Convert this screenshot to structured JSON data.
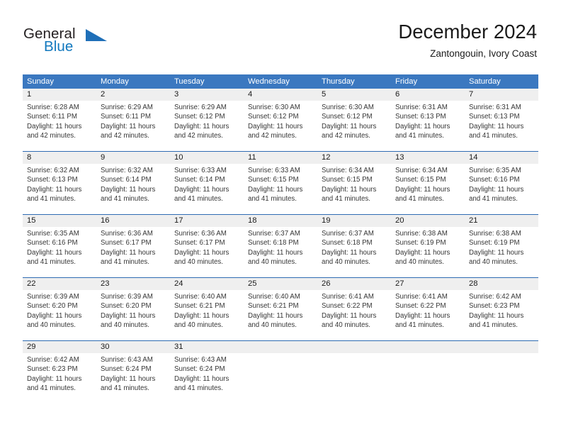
{
  "brand": {
    "name_part1": "General",
    "name_part2": "Blue",
    "triangle_icon": "triangle-icon",
    "colors": {
      "general": "#231f20",
      "blue": "#1278be",
      "triangle": "#1f6fb8"
    }
  },
  "header": {
    "title": "December 2024",
    "subtitle": "Zantongouin, Ivory Coast"
  },
  "theme": {
    "header_bar": "#3b78c0",
    "header_text": "#ffffff",
    "day_number_band": "#efefef",
    "separator": "#2f6cb3",
    "body_text": "#363636"
  },
  "weekdays": [
    "Sunday",
    "Monday",
    "Tuesday",
    "Wednesday",
    "Thursday",
    "Friday",
    "Saturday"
  ],
  "weeks": [
    {
      "days": [
        {
          "num": "1",
          "sunrise": "Sunrise: 6:28 AM",
          "sunset": "Sunset: 6:11 PM",
          "daylight1": "Daylight: 11 hours",
          "daylight2": "and 42 minutes."
        },
        {
          "num": "2",
          "sunrise": "Sunrise: 6:29 AM",
          "sunset": "Sunset: 6:11 PM",
          "daylight1": "Daylight: 11 hours",
          "daylight2": "and 42 minutes."
        },
        {
          "num": "3",
          "sunrise": "Sunrise: 6:29 AM",
          "sunset": "Sunset: 6:12 PM",
          "daylight1": "Daylight: 11 hours",
          "daylight2": "and 42 minutes."
        },
        {
          "num": "4",
          "sunrise": "Sunrise: 6:30 AM",
          "sunset": "Sunset: 6:12 PM",
          "daylight1": "Daylight: 11 hours",
          "daylight2": "and 42 minutes."
        },
        {
          "num": "5",
          "sunrise": "Sunrise: 6:30 AM",
          "sunset": "Sunset: 6:12 PM",
          "daylight1": "Daylight: 11 hours",
          "daylight2": "and 42 minutes."
        },
        {
          "num": "6",
          "sunrise": "Sunrise: 6:31 AM",
          "sunset": "Sunset: 6:13 PM",
          "daylight1": "Daylight: 11 hours",
          "daylight2": "and 41 minutes."
        },
        {
          "num": "7",
          "sunrise": "Sunrise: 6:31 AM",
          "sunset": "Sunset: 6:13 PM",
          "daylight1": "Daylight: 11 hours",
          "daylight2": "and 41 minutes."
        }
      ]
    },
    {
      "days": [
        {
          "num": "8",
          "sunrise": "Sunrise: 6:32 AM",
          "sunset": "Sunset: 6:13 PM",
          "daylight1": "Daylight: 11 hours",
          "daylight2": "and 41 minutes."
        },
        {
          "num": "9",
          "sunrise": "Sunrise: 6:32 AM",
          "sunset": "Sunset: 6:14 PM",
          "daylight1": "Daylight: 11 hours",
          "daylight2": "and 41 minutes."
        },
        {
          "num": "10",
          "sunrise": "Sunrise: 6:33 AM",
          "sunset": "Sunset: 6:14 PM",
          "daylight1": "Daylight: 11 hours",
          "daylight2": "and 41 minutes."
        },
        {
          "num": "11",
          "sunrise": "Sunrise: 6:33 AM",
          "sunset": "Sunset: 6:15 PM",
          "daylight1": "Daylight: 11 hours",
          "daylight2": "and 41 minutes."
        },
        {
          "num": "12",
          "sunrise": "Sunrise: 6:34 AM",
          "sunset": "Sunset: 6:15 PM",
          "daylight1": "Daylight: 11 hours",
          "daylight2": "and 41 minutes."
        },
        {
          "num": "13",
          "sunrise": "Sunrise: 6:34 AM",
          "sunset": "Sunset: 6:15 PM",
          "daylight1": "Daylight: 11 hours",
          "daylight2": "and 41 minutes."
        },
        {
          "num": "14",
          "sunrise": "Sunrise: 6:35 AM",
          "sunset": "Sunset: 6:16 PM",
          "daylight1": "Daylight: 11 hours",
          "daylight2": "and 41 minutes."
        }
      ]
    },
    {
      "days": [
        {
          "num": "15",
          "sunrise": "Sunrise: 6:35 AM",
          "sunset": "Sunset: 6:16 PM",
          "daylight1": "Daylight: 11 hours",
          "daylight2": "and 41 minutes."
        },
        {
          "num": "16",
          "sunrise": "Sunrise: 6:36 AM",
          "sunset": "Sunset: 6:17 PM",
          "daylight1": "Daylight: 11 hours",
          "daylight2": "and 41 minutes."
        },
        {
          "num": "17",
          "sunrise": "Sunrise: 6:36 AM",
          "sunset": "Sunset: 6:17 PM",
          "daylight1": "Daylight: 11 hours",
          "daylight2": "and 40 minutes."
        },
        {
          "num": "18",
          "sunrise": "Sunrise: 6:37 AM",
          "sunset": "Sunset: 6:18 PM",
          "daylight1": "Daylight: 11 hours",
          "daylight2": "and 40 minutes."
        },
        {
          "num": "19",
          "sunrise": "Sunrise: 6:37 AM",
          "sunset": "Sunset: 6:18 PM",
          "daylight1": "Daylight: 11 hours",
          "daylight2": "and 40 minutes."
        },
        {
          "num": "20",
          "sunrise": "Sunrise: 6:38 AM",
          "sunset": "Sunset: 6:19 PM",
          "daylight1": "Daylight: 11 hours",
          "daylight2": "and 40 minutes."
        },
        {
          "num": "21",
          "sunrise": "Sunrise: 6:38 AM",
          "sunset": "Sunset: 6:19 PM",
          "daylight1": "Daylight: 11 hours",
          "daylight2": "and 40 minutes."
        }
      ]
    },
    {
      "days": [
        {
          "num": "22",
          "sunrise": "Sunrise: 6:39 AM",
          "sunset": "Sunset: 6:20 PM",
          "daylight1": "Daylight: 11 hours",
          "daylight2": "and 40 minutes."
        },
        {
          "num": "23",
          "sunrise": "Sunrise: 6:39 AM",
          "sunset": "Sunset: 6:20 PM",
          "daylight1": "Daylight: 11 hours",
          "daylight2": "and 40 minutes."
        },
        {
          "num": "24",
          "sunrise": "Sunrise: 6:40 AM",
          "sunset": "Sunset: 6:21 PM",
          "daylight1": "Daylight: 11 hours",
          "daylight2": "and 40 minutes."
        },
        {
          "num": "25",
          "sunrise": "Sunrise: 6:40 AM",
          "sunset": "Sunset: 6:21 PM",
          "daylight1": "Daylight: 11 hours",
          "daylight2": "and 40 minutes."
        },
        {
          "num": "26",
          "sunrise": "Sunrise: 6:41 AM",
          "sunset": "Sunset: 6:22 PM",
          "daylight1": "Daylight: 11 hours",
          "daylight2": "and 40 minutes."
        },
        {
          "num": "27",
          "sunrise": "Sunrise: 6:41 AM",
          "sunset": "Sunset: 6:22 PM",
          "daylight1": "Daylight: 11 hours",
          "daylight2": "and 41 minutes."
        },
        {
          "num": "28",
          "sunrise": "Sunrise: 6:42 AM",
          "sunset": "Sunset: 6:23 PM",
          "daylight1": "Daylight: 11 hours",
          "daylight2": "and 41 minutes."
        }
      ]
    },
    {
      "days": [
        {
          "num": "29",
          "sunrise": "Sunrise: 6:42 AM",
          "sunset": "Sunset: 6:23 PM",
          "daylight1": "Daylight: 11 hours",
          "daylight2": "and 41 minutes."
        },
        {
          "num": "30",
          "sunrise": "Sunrise: 6:43 AM",
          "sunset": "Sunset: 6:24 PM",
          "daylight1": "Daylight: 11 hours",
          "daylight2": "and 41 minutes."
        },
        {
          "num": "31",
          "sunrise": "Sunrise: 6:43 AM",
          "sunset": "Sunset: 6:24 PM",
          "daylight1": "Daylight: 11 hours",
          "daylight2": "and 41 minutes."
        },
        {
          "num": "",
          "sunrise": "",
          "sunset": "",
          "daylight1": "",
          "daylight2": ""
        },
        {
          "num": "",
          "sunrise": "",
          "sunset": "",
          "daylight1": "",
          "daylight2": ""
        },
        {
          "num": "",
          "sunrise": "",
          "sunset": "",
          "daylight1": "",
          "daylight2": ""
        },
        {
          "num": "",
          "sunrise": "",
          "sunset": "",
          "daylight1": "",
          "daylight2": ""
        }
      ]
    }
  ]
}
